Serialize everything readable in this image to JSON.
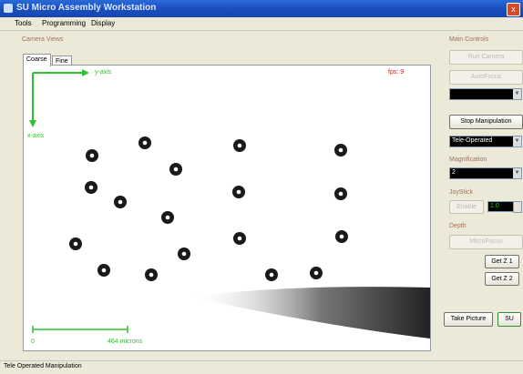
{
  "window": {
    "title": "SU Micro Assembly Workstation",
    "close_glyph": "x"
  },
  "menu": [
    "Tools",
    "Programming",
    "Display"
  ],
  "camera_views": {
    "group_label": "Camera Views",
    "tabs": [
      "Coarse",
      "Fine"
    ],
    "fps_label": "fps: 9",
    "y_axis_label": "y-axis",
    "x_axis_label": "x-axis",
    "scale_zero": "0",
    "scale_label": "464 microns",
    "accent_color": "#2fbf2f"
  },
  "main_controls": {
    "group_label": "Main Controls",
    "run_camera": "Run Camera",
    "autofocus": "AutoFocus",
    "stop_manipulation": "Stop Manipulation",
    "mode_value": "Tele-Operated"
  },
  "magnification": {
    "group_label": "Magnification",
    "value": "2"
  },
  "joystick": {
    "group_label": "JoyStick",
    "enable": "Enable",
    "value": "1.0"
  },
  "depth": {
    "group_label": "Depth",
    "microfocus": "MicroFocus",
    "get_z1": "Get Z 1",
    "get_z2": "Get Z 2"
  },
  "take_picture": "Take Picture",
  "su_button": "SU",
  "status": "Tele Operated Manipulation"
}
